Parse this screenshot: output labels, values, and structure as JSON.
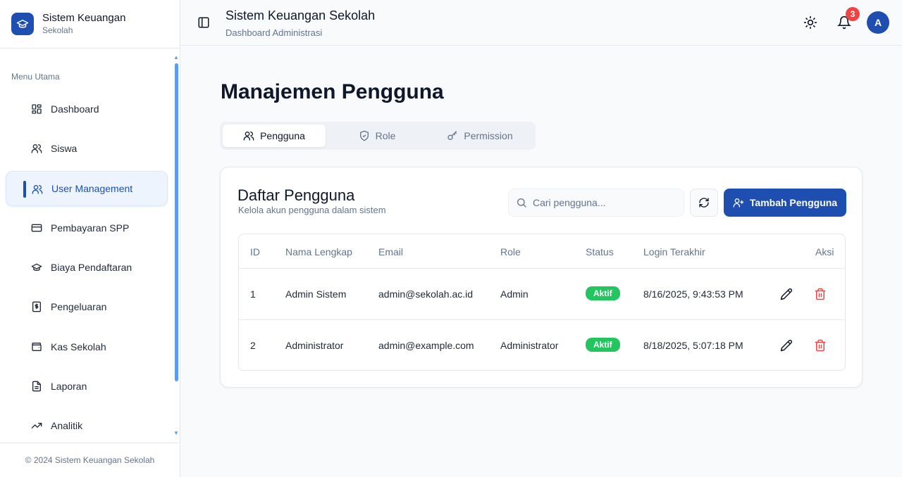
{
  "brand": {
    "title": "Sistem Keuangan",
    "subtitle": "Sekolah",
    "icon": "graduation-cap-icon"
  },
  "sidebar": {
    "menu_label": "Menu Utama",
    "items": [
      {
        "label": "Dashboard",
        "icon": "dashboard-icon",
        "active": false
      },
      {
        "label": "Siswa",
        "icon": "users-icon",
        "active": false
      },
      {
        "label": "User Management",
        "icon": "users-icon",
        "active": true
      },
      {
        "label": "Pembayaran SPP",
        "icon": "credit-card-icon",
        "active": false
      },
      {
        "label": "Biaya Pendaftaran",
        "icon": "graduation-cap-icon",
        "active": false
      },
      {
        "label": "Pengeluaran",
        "icon": "receipt-icon",
        "active": false
      },
      {
        "label": "Kas Sekolah",
        "icon": "wallet-icon",
        "active": false
      },
      {
        "label": "Laporan",
        "icon": "file-icon",
        "active": false
      },
      {
        "label": "Analitik",
        "icon": "trending-up-icon",
        "active": false
      }
    ],
    "footer": "© 2024 Sistem Keuangan Sekolah"
  },
  "header": {
    "title": "Sistem Keuangan Sekolah",
    "subtitle": "Dashboard Administrasi",
    "notification_count": "3",
    "avatar_initial": "A"
  },
  "main": {
    "page_title": "Manajemen Pengguna",
    "tabs": [
      {
        "label": "Pengguna",
        "icon": "users-icon",
        "active": true
      },
      {
        "label": "Role",
        "icon": "shield-icon",
        "active": false
      },
      {
        "label": "Permission",
        "icon": "key-icon",
        "active": false
      }
    ],
    "card": {
      "title": "Daftar Pengguna",
      "subtitle": "Kelola akun pengguna dalam sistem",
      "search_placeholder": "Cari pengguna...",
      "add_button": "Tambah Pengguna"
    },
    "table": {
      "columns": [
        "ID",
        "Nama Lengkap",
        "Email",
        "Role",
        "Status",
        "Login Terakhir",
        "Aksi"
      ],
      "rows": [
        {
          "id": "1",
          "name": "Admin Sistem",
          "email": "admin@sekolah.ac.id",
          "role": "Admin",
          "status": "Aktif",
          "last_login": "8/16/2025, 9:43:53 PM"
        },
        {
          "id": "2",
          "name": "Administrator",
          "email": "admin@example.com",
          "role": "Administrator",
          "status": "Aktif",
          "last_login": "8/18/2025, 5:07:18 PM"
        }
      ]
    }
  },
  "colors": {
    "primary": "#1e4fb0",
    "status_active": "#22c55e",
    "danger": "#ef4444",
    "scrollbar": "#5b9bf5"
  }
}
